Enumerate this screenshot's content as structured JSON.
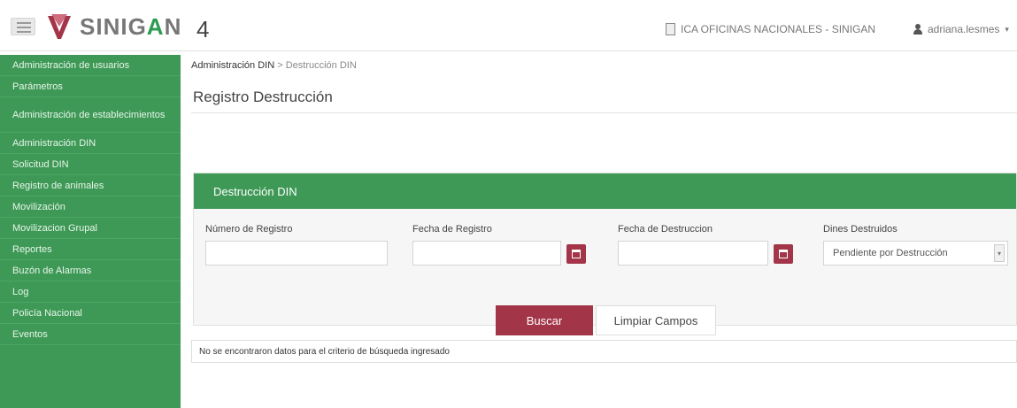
{
  "header": {
    "brand_prefix": "SINIG",
    "brand_highlight": "A",
    "brand_rest": "N",
    "brand_suffix": "4",
    "office": "ICA OFICINAS NACIONALES - SINIGAN",
    "user": "adriana.lesmes",
    "user_caret": "▾"
  },
  "sidebar": {
    "items": [
      {
        "label": "Administración de usuarios"
      },
      {
        "label": "Parámetros"
      },
      {
        "label": "Administración de establecimientos"
      },
      {
        "label": "Administración DIN"
      },
      {
        "label": "Solicitud DIN"
      },
      {
        "label": "Registro de animales"
      },
      {
        "label": "Movilización"
      },
      {
        "label": "Movilizacion Grupal"
      },
      {
        "label": "Reportes"
      },
      {
        "label": "Buzón de Alarmas"
      },
      {
        "label": "Log"
      },
      {
        "label": "Policía Nacional"
      },
      {
        "label": "Eventos"
      }
    ]
  },
  "breadcrumb": {
    "parent": "Administración DIN",
    "separator": ">",
    "current": "Destrucción DIN"
  },
  "page": {
    "title": "Registro Destrucción"
  },
  "panel": {
    "title": "Destrucción DIN",
    "fields": {
      "numero_registro": {
        "label": "Número de Registro",
        "value": ""
      },
      "fecha_registro": {
        "label": "Fecha de Registro",
        "value": ""
      },
      "fecha_destruccion": {
        "label": "Fecha de Destruccion",
        "value": ""
      },
      "dines_destruidos": {
        "label": "Dines Destruidos",
        "value": "Pendiente por Destrucción"
      }
    },
    "buttons": {
      "search": "Buscar",
      "clear": "Limpiar Campos"
    }
  },
  "results": {
    "message": "No se encontraron datos para el criterio de búsqueda ingresado"
  },
  "colors": {
    "green": "#3e9956",
    "maroon": "#a33549"
  }
}
